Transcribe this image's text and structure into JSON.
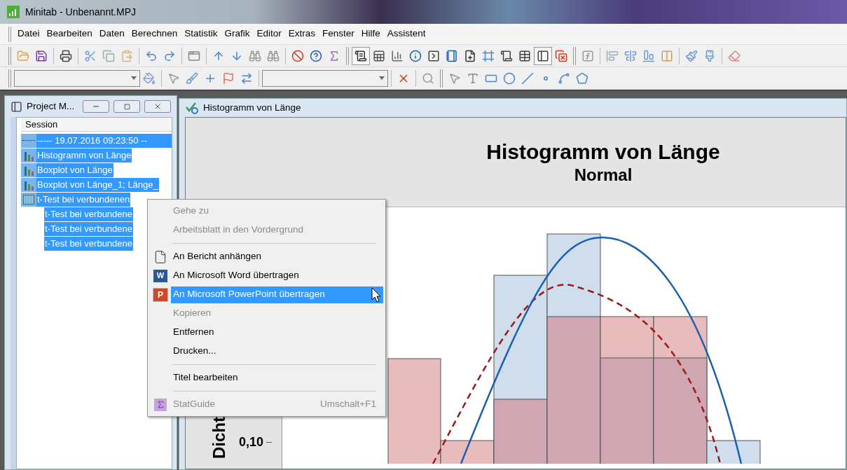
{
  "window": {
    "title": "Minitab - Unbenannt.MPJ"
  },
  "menu_bar": [
    "Datei",
    "Bearbeiten",
    "Daten",
    "Berechnen",
    "Statistik",
    "Grafik",
    "Editor",
    "Extras",
    "Fenster",
    "Hilfe",
    "Assistent"
  ],
  "toolbars": [
    [
      {
        "kind": "grip"
      },
      {
        "kind": "button",
        "pressed": false
      },
      {
        "kind": "button",
        "pressed": false
      },
      {
        "kind": "separator"
      },
      {
        "kind": "button",
        "pressed": false
      },
      {
        "kind": "separator"
      },
      {
        "kind": "button",
        "pressed": false
      },
      {
        "kind": "button",
        "pressed": false
      },
      {
        "kind": "button",
        "pressed": false
      },
      {
        "kind": "separator"
      },
      {
        "kind": "button",
        "pressed": false
      },
      {
        "kind": "button",
        "pressed": false
      },
      {
        "kind": "separator"
      },
      {
        "kind": "button",
        "pressed": false
      },
      {
        "kind": "separator"
      },
      {
        "kind": "button",
        "pressed": false
      },
      {
        "kind": "button",
        "pressed": false
      },
      {
        "kind": "button",
        "pressed": false
      },
      {
        "kind": "button",
        "pressed": false
      },
      {
        "kind": "separator"
      },
      {
        "kind": "button",
        "pressed": false
      },
      {
        "kind": "button",
        "pressed": false
      },
      {
        "kind": "button",
        "pressed": false
      },
      {
        "kind": "grip"
      },
      {
        "kind": "button",
        "pressed": true
      },
      {
        "kind": "button",
        "pressed": false
      },
      {
        "kind": "button",
        "pressed": false
      },
      {
        "kind": "button",
        "pressed": false
      },
      {
        "kind": "button",
        "pressed": false
      },
      {
        "kind": "button",
        "pressed": false
      },
      {
        "kind": "button",
        "pressed": false
      },
      {
        "kind": "button",
        "pressed": false
      },
      {
        "kind": "button",
        "pressed": false
      },
      {
        "kind": "button",
        "pressed": false
      },
      {
        "kind": "button",
        "pressed": true
      },
      {
        "kind": "button",
        "pressed": false
      },
      {
        "kind": "grip"
      },
      {
        "kind": "button",
        "pressed": false
      },
      {
        "kind": "separator"
      },
      {
        "kind": "button",
        "pressed": false
      },
      {
        "kind": "button",
        "pressed": false
      },
      {
        "kind": "button",
        "pressed": false
      },
      {
        "kind": "button",
        "pressed": false
      },
      {
        "kind": "separator"
      },
      {
        "kind": "button",
        "pressed": false
      },
      {
        "kind": "button",
        "pressed": false
      },
      {
        "kind": "separator"
      },
      {
        "kind": "button",
        "pressed": false
      }
    ],
    [
      {
        "kind": "grip"
      },
      {
        "kind": "dropdown"
      },
      {
        "kind": "button",
        "pressed": false
      },
      {
        "kind": "separator"
      },
      {
        "kind": "button",
        "pressed": false
      },
      {
        "kind": "button",
        "pressed": false
      },
      {
        "kind": "button",
        "pressed": false
      },
      {
        "kind": "button",
        "pressed": false
      },
      {
        "kind": "button",
        "pressed": false
      },
      {
        "kind": "separator"
      },
      {
        "kind": "dropdown"
      },
      {
        "kind": "separator"
      },
      {
        "kind": "button",
        "pressed": false
      },
      {
        "kind": "separator"
      },
      {
        "kind": "button",
        "pressed": false
      },
      {
        "kind": "grip"
      },
      {
        "kind": "button",
        "pressed": false
      },
      {
        "kind": "button",
        "pressed": false
      },
      {
        "kind": "button",
        "pressed": false
      },
      {
        "kind": "button",
        "pressed": false
      },
      {
        "kind": "button",
        "pressed": false
      },
      {
        "kind": "button",
        "pressed": false
      },
      {
        "kind": "button",
        "pressed": false
      },
      {
        "kind": "button",
        "pressed": false
      }
    ]
  ],
  "project_manager": {
    "title": "Project M...",
    "column": "Session",
    "tree": [
      {
        "kind": "session",
        "label": "-----   19.07.2016 09:23:50   --",
        "selected": true
      },
      {
        "kind": "graph",
        "label": "Histogramm von Länge",
        "selected": true
      },
      {
        "kind": "graph",
        "label": "Boxplot von Länge",
        "selected": true
      },
      {
        "kind": "graph",
        "label": "Boxplot von Länge_1; Länge_",
        "selected": true
      },
      {
        "kind": "table",
        "label": "t-Test bei verbundenen",
        "selected": true,
        "children": [
          {
            "label": "t-Test bei verbundene",
            "selected": true
          },
          {
            "label": "t-Test bei verbundene",
            "selected": true
          },
          {
            "label": "t-Test bei verbundene",
            "selected": true
          }
        ]
      }
    ]
  },
  "graph_window": {
    "title": "Histogramm von Länge",
    "graph_title": "Histogramm von Länge",
    "graph_subtitle": "Normal",
    "y_axis_label": "Dicht",
    "y_tick": "0,10"
  },
  "context_menu": [
    {
      "kind": "plain",
      "label": "Gehe zu",
      "disabled": true,
      "selected": false
    },
    {
      "kind": "plain",
      "label": "Arbeitsblatt in den Vordergrund",
      "disabled": true,
      "selected": false
    },
    {
      "kind": "separator"
    },
    {
      "kind": "page",
      "label": "An Bericht anhängen",
      "disabled": false,
      "selected": false
    },
    {
      "kind": "word",
      "label": "An Microsoft Word übertragen",
      "disabled": false,
      "selected": false,
      "logo_letter": "W"
    },
    {
      "kind": "powerpoint",
      "label": "An Microsoft PowerPoint übertragen",
      "disabled": false,
      "selected": true,
      "logo_letter": "P"
    },
    {
      "kind": "plain",
      "label": "Kopieren",
      "disabled": true,
      "selected": false
    },
    {
      "kind": "plain",
      "label": "Entfernen",
      "disabled": false,
      "selected": false
    },
    {
      "kind": "plain",
      "label": "Drucken...",
      "disabled": false,
      "selected": false
    },
    {
      "kind": "separator"
    },
    {
      "kind": "plain",
      "label": "Titel bearbeiten",
      "disabled": false,
      "selected": false
    },
    {
      "kind": "separator"
    },
    {
      "kind": "sigma",
      "label": "StatGuide",
      "disabled": true,
      "selected": false,
      "shortcut": "Umschalt+F1"
    }
  ]
}
